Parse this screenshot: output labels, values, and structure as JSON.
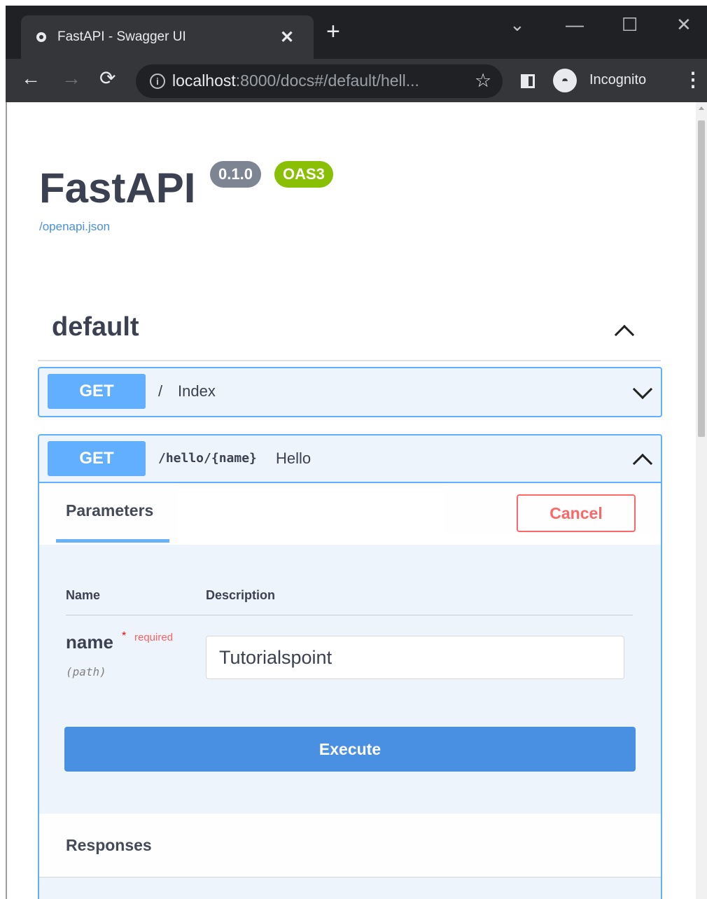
{
  "browser": {
    "tab_title": "FastAPI - Swagger UI",
    "tab_close": "✕",
    "new_tab": "+",
    "url_host": "localhost",
    "url_rest": ":8000/docs#/default/hell...",
    "profile_label": "Incognito",
    "window_controls": {
      "dropdown": "⌄",
      "minimize": "—",
      "maximize": "☐",
      "close": "✕"
    }
  },
  "page": {
    "title": "FastAPI",
    "version_badge": "0.1.0",
    "oas_badge": "OAS3",
    "spec_link": "/openapi.json"
  },
  "tag": {
    "name": "default"
  },
  "operations": [
    {
      "method": "GET",
      "path": "/",
      "description": "Index"
    },
    {
      "method": "GET",
      "path": "/hello/{name}",
      "description": "Hello"
    }
  ],
  "params_panel": {
    "tab_label": "Parameters",
    "cancel_label": "Cancel",
    "col_name": "Name",
    "col_description": "Description",
    "param_name": "name",
    "required_star": "*",
    "required_label": "required",
    "param_in": "(path)",
    "param_value": "Tutorialspoint",
    "execute_label": "Execute"
  },
  "responses": {
    "title": "Responses"
  },
  "colors": {
    "get": "#61affe",
    "execute": "#4990e2",
    "cancel": "#ff6060",
    "oas": "#89bf04"
  }
}
